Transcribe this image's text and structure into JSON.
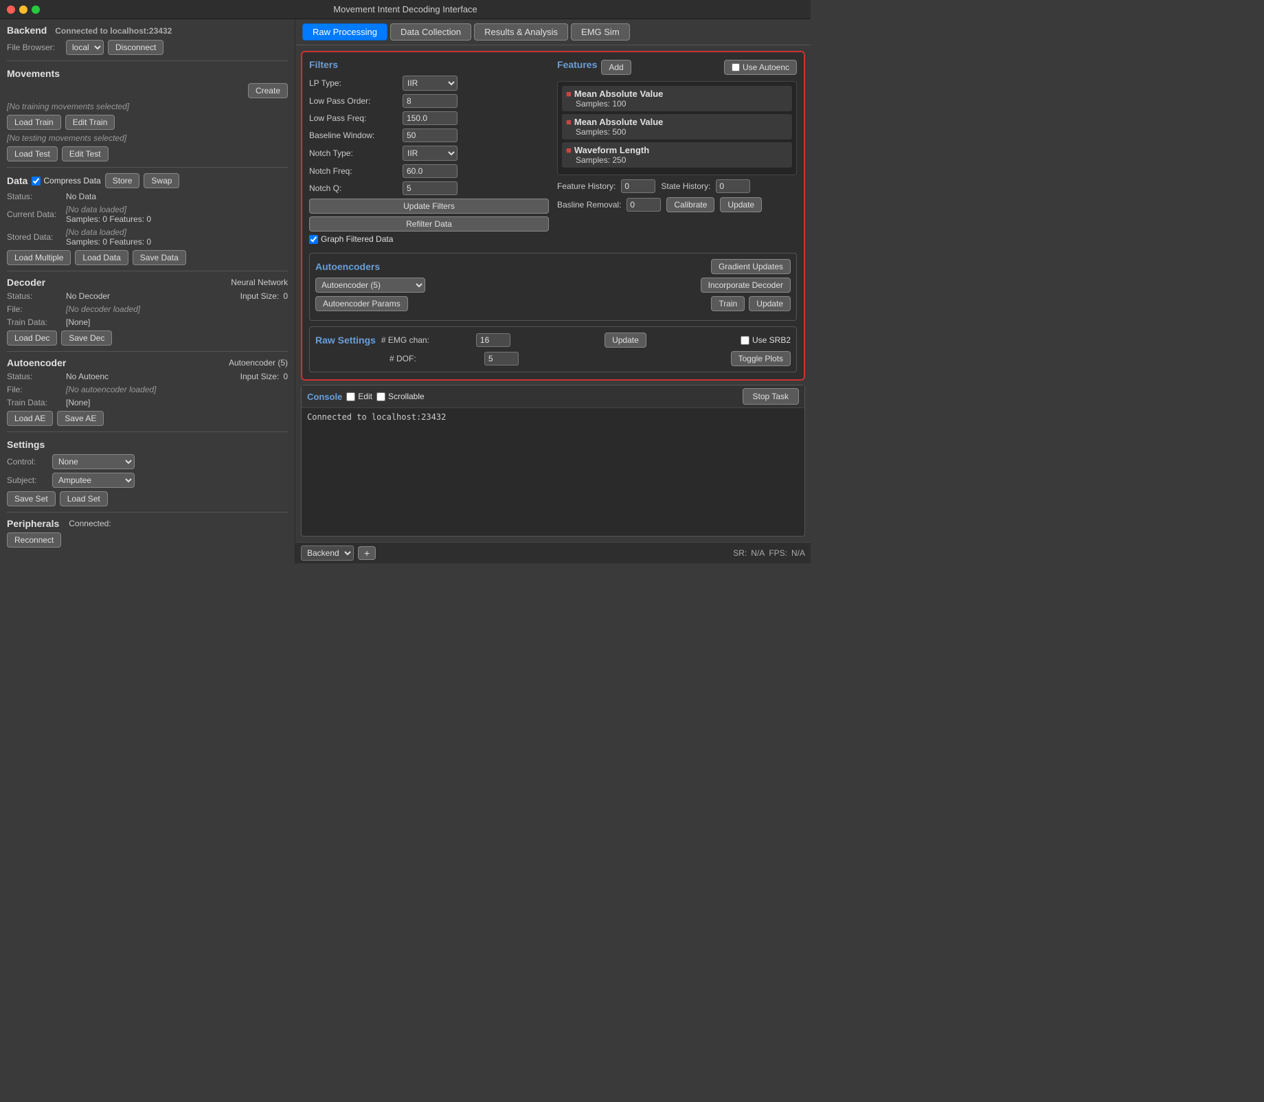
{
  "titlebar": {
    "title": "Movement Intent Decoding Interface"
  },
  "sidebar": {
    "backend_header": "Backend",
    "backend_status": "Connected to localhost:23432",
    "file_browser_label": "File Browser:",
    "file_browser_value": "local",
    "disconnect_btn": "Disconnect",
    "movements_header": "Movements",
    "create_btn": "Create",
    "no_training": "[No training movements selected]",
    "load_train_btn": "Load Train",
    "edit_train_btn": "Edit Train",
    "no_testing": "[No testing movements selected]",
    "load_test_btn": "Load Test",
    "edit_test_btn": "Edit Test",
    "data_header": "Data",
    "compress_data_label": "Compress Data",
    "store_btn": "Store",
    "swap_btn": "Swap",
    "status_label": "Status:",
    "status_value": "No Data",
    "current_data_label": "Current Data:",
    "current_data_line1": "[No data loaded]",
    "current_data_line2": "Samples: 0  Features: 0",
    "stored_data_label": "Stored Data:",
    "stored_data_line1": "[No data loaded]",
    "stored_data_line2": "Samples: 0  Features: 0",
    "load_multiple_btn": "Load Multiple",
    "load_data_btn": "Load Data",
    "save_data_btn": "Save Data",
    "decoder_header": "Decoder",
    "decoder_type": "Neural Network",
    "decoder_status_label": "Status:",
    "decoder_status_value": "No Decoder",
    "input_size_label": "Input Size:",
    "input_size_value": "0",
    "file_label": "File:",
    "file_value": "[No decoder loaded]",
    "train_data_label": "Train Data:",
    "train_data_value": "[None]",
    "load_dec_btn": "Load Dec",
    "save_dec_btn": "Save Dec",
    "autoencoder_header": "Autoencoder",
    "autoencoder_type": "Autoencoder (5)",
    "ae_status_label": "Status:",
    "ae_status_value": "No Autoenc",
    "ae_input_size_label": "Input Size:",
    "ae_input_size_value": "0",
    "ae_file_label": "File:",
    "ae_file_value": "[No autoencoder loaded]",
    "ae_train_data_label": "Train Data:",
    "ae_train_data_value": "[None]",
    "load_ae_btn": "Load AE",
    "save_ae_btn": "Save AE",
    "settings_header": "Settings",
    "control_label": "Control:",
    "control_value": "None",
    "subject_label": "Subject:",
    "subject_value": "Amputee",
    "save_set_btn": "Save Set",
    "load_set_btn": "Load Set",
    "peripherals_header": "Peripherals",
    "peripherals_status": "Connected:",
    "reconnect_btn": "Reconnect"
  },
  "tabs": [
    {
      "id": "raw",
      "label": "Raw Processing",
      "active": true
    },
    {
      "id": "data",
      "label": "Data Collection",
      "active": false
    },
    {
      "id": "results",
      "label": "Results & Analysis",
      "active": false
    },
    {
      "id": "emg",
      "label": "EMG Sim",
      "active": false
    }
  ],
  "filters": {
    "title": "Filters",
    "lp_type_label": "LP Type:",
    "lp_type_value": "IIR",
    "lp_order_label": "Low Pass Order:",
    "lp_order_value": "8",
    "lp_freq_label": "Low Pass Freq:",
    "lp_freq_value": "150.0",
    "baseline_label": "Baseline Window:",
    "baseline_value": "50",
    "notch_type_label": "Notch Type:",
    "notch_type_value": "IIR",
    "notch_freq_label": "Notch Freq:",
    "notch_freq_value": "60.0",
    "notch_q_label": "Notch Q:",
    "notch_q_value": "5",
    "update_filters_btn": "Update Filters",
    "refilter_data_btn": "Refilter Data",
    "graph_filtered_label": "Graph Filtered Data"
  },
  "features": {
    "title": "Features",
    "add_btn": "Add",
    "use_autoenc_btn": "Use Autoenc",
    "items": [
      {
        "name": "Mean Absolute Value",
        "samples_label": "Samples:",
        "samples_value": "100"
      },
      {
        "name": "Mean Absolute Value",
        "samples_label": "Samples:",
        "samples_value": "500"
      },
      {
        "name": "Waveform Length",
        "samples_label": "Samples:",
        "samples_value": "250"
      }
    ],
    "feature_history_label": "Feature History:",
    "feature_history_value": "0",
    "state_history_label": "State History:",
    "state_history_value": "0",
    "baseline_removal_label": "Basline Removal:",
    "baseline_removal_value": "0",
    "calibrate_btn": "Calibrate",
    "update_btn": "Update"
  },
  "autoencoders": {
    "title": "Autoencoders",
    "gradient_updates_btn": "Gradient Updates",
    "ae_select_value": "Autoencoder (5)",
    "incorporate_decoder_btn": "Incorporate Decoder",
    "ae_params_btn": "Autoencoder Params",
    "train_btn": "Train",
    "update_btn": "Update"
  },
  "raw_settings": {
    "title": "Raw Settings",
    "emg_chan_label": "# EMG chan:",
    "emg_chan_value": "16",
    "dof_label": "# DOF:",
    "dof_value": "5",
    "update_btn": "Update",
    "use_srb2_label": "Use SRB2",
    "toggle_plots_btn": "Toggle Plots"
  },
  "console": {
    "title": "Console",
    "edit_label": "Edit",
    "scrollable_label": "Scrollable",
    "stop_task_btn": "Stop Task",
    "content": "Connected to localhost:23432"
  },
  "status_bar": {
    "backend_label": "Backend",
    "plus_btn": "+",
    "sr_label": "SR:",
    "sr_value": "N/A",
    "fps_label": "FPS:",
    "fps_value": "N/A"
  }
}
